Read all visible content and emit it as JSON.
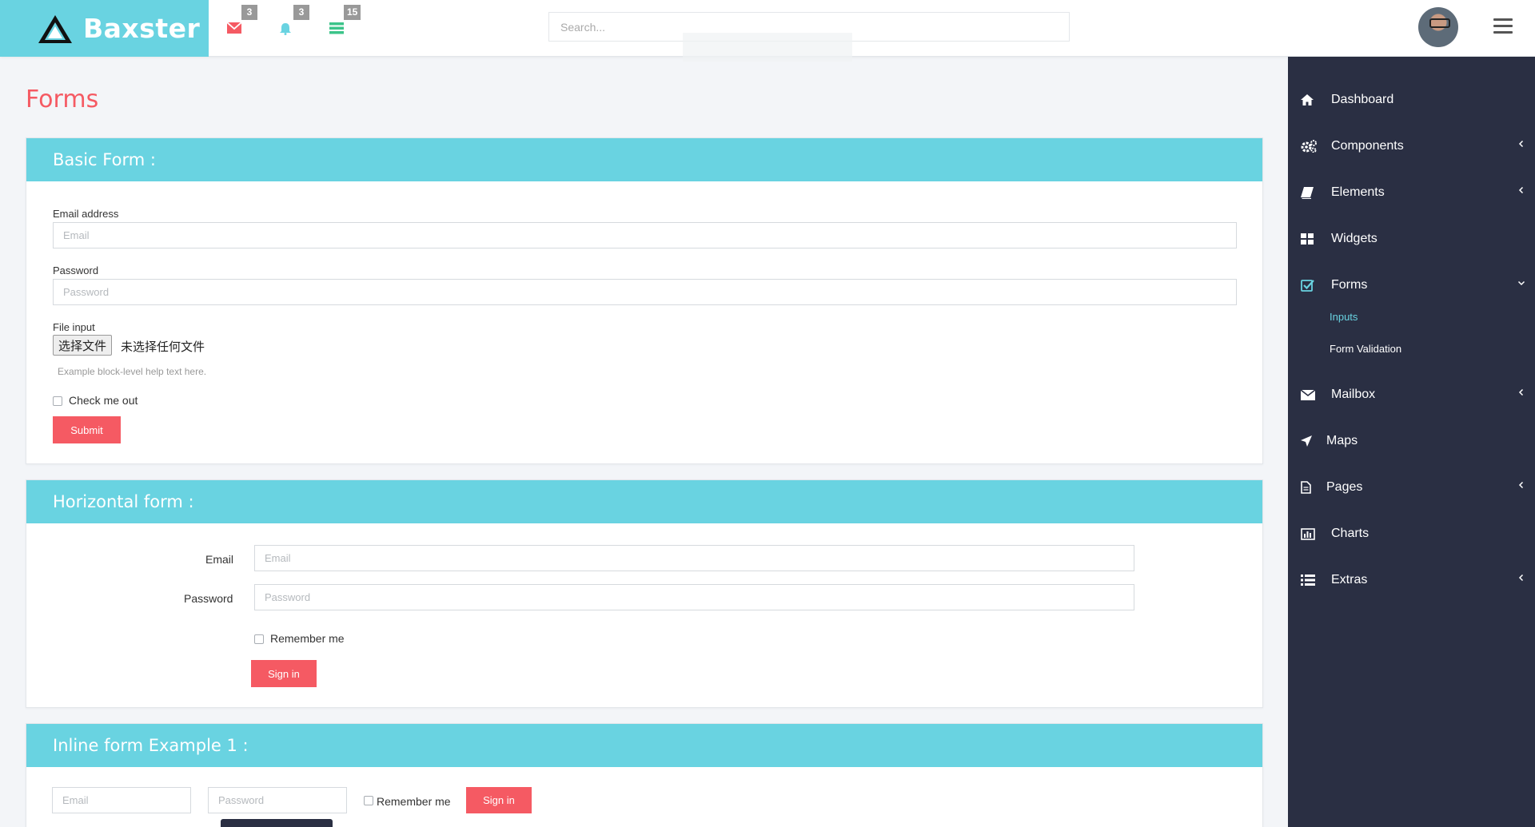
{
  "brand": {
    "name": "Baxster"
  },
  "header": {
    "mail_badge": "3",
    "bell_badge": "3",
    "tasks_badge": "15",
    "search_placeholder": "Search..."
  },
  "page": {
    "title": "Forms"
  },
  "sidebar": {
    "items": [
      {
        "label": "Dashboard",
        "icon": "home-icon"
      },
      {
        "label": "Components",
        "icon": "cogs-icon"
      },
      {
        "label": "Elements",
        "icon": "book-icon"
      },
      {
        "label": "Widgets",
        "icon": "grid-icon"
      },
      {
        "label": "Forms",
        "icon": "check-square-icon"
      },
      {
        "label": "Mailbox",
        "icon": "envelope-icon"
      },
      {
        "label": "Maps",
        "icon": "location-arrow-icon"
      },
      {
        "label": "Pages",
        "icon": "file-icon"
      },
      {
        "label": "Charts",
        "icon": "bar-chart-icon"
      },
      {
        "label": "Extras",
        "icon": "list-icon"
      }
    ],
    "forms_sub": [
      {
        "label": "Inputs"
      },
      {
        "label": "Form Validation"
      }
    ]
  },
  "basic_form": {
    "title": "Basic Form :",
    "email_label": "Email address",
    "email_placeholder": "Email",
    "password_label": "Password",
    "password_placeholder": "Password",
    "file_label": "File input",
    "file_button": "选择文件",
    "file_status": "未选择任何文件",
    "help_text": "Example block-level help text here.",
    "check_label": "Check me out",
    "submit_label": "Submit"
  },
  "horizontal_form": {
    "title": "Horizontal form :",
    "email_label": "Email",
    "email_placeholder": "Email",
    "password_label": "Password",
    "password_placeholder": "Password",
    "remember_label": "Remember me",
    "signin_label": "Sign in"
  },
  "inline_form": {
    "title": "Inline form Example 1 :",
    "email_placeholder": "Email",
    "password_placeholder": "Password",
    "remember_label": "Remember me",
    "signin_label": "Sign in"
  },
  "colors": {
    "brand": "#69d3e1",
    "accent": "#f55a63",
    "sidebar_bg": "#2a2f43"
  }
}
